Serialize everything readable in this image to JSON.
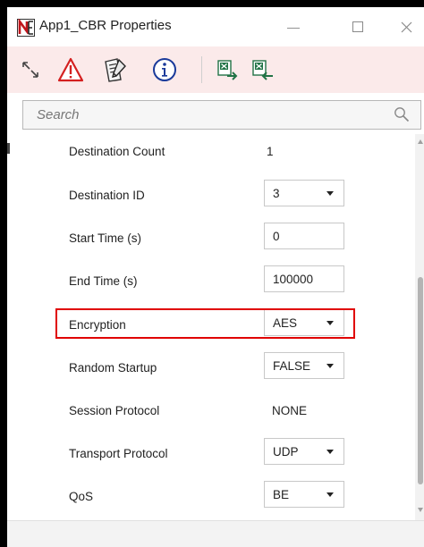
{
  "window": {
    "title": "App1_CBR Properties",
    "minimize_glyph": "—",
    "maximize_glyph": "☐",
    "close_glyph": "✕"
  },
  "toolbar": {
    "icons": [
      "expand-arrows-icon",
      "warning-icon",
      "edit-document-icon",
      "info-icon",
      "excel-export-icon",
      "excel-import-icon"
    ]
  },
  "search": {
    "placeholder": "Search",
    "value": ""
  },
  "properties": [
    {
      "label": "Destination Count",
      "value": "1",
      "type": "text"
    },
    {
      "label": "Destination ID",
      "value": "3",
      "type": "dropdown"
    },
    {
      "label": "Start Time (s)",
      "value": "0",
      "type": "input"
    },
    {
      "label": "End Time (s)",
      "value": "100000",
      "type": "input"
    },
    {
      "label": "Encryption",
      "value": "AES",
      "type": "dropdown",
      "highlighted": true
    },
    {
      "label": "Random Startup",
      "value": "FALSE",
      "type": "dropdown"
    },
    {
      "label": "Session Protocol",
      "value": "NONE",
      "type": "text"
    },
    {
      "label": "Transport Protocol",
      "value": "UDP",
      "type": "dropdown"
    },
    {
      "label": "QoS",
      "value": "BE",
      "type": "dropdown"
    }
  ],
  "colors": {
    "toolbar_bg": "#fbeaea",
    "highlight": "#e00000",
    "warning_red": "#d42020",
    "info_blue": "#1a3a9a",
    "excel_green": "#217346"
  }
}
